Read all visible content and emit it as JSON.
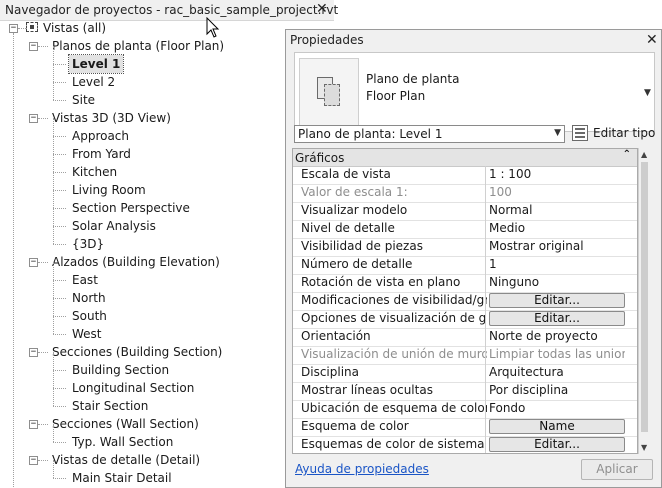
{
  "browser": {
    "title": "Navegador de proyectos - rac_basic_sample_project.rvt",
    "close": "✕",
    "root": "Vistas (all)",
    "tree": [
      {
        "label": "Planos de planta (Floor Plan)",
        "level": 1,
        "toggle": "−"
      },
      {
        "label": "Level 1",
        "level": 2,
        "selected": true
      },
      {
        "label": "Level 2",
        "level": 2
      },
      {
        "label": "Site",
        "level": 2
      },
      {
        "label": "Vistas 3D (3D View)",
        "level": 1,
        "toggle": "−"
      },
      {
        "label": "Approach",
        "level": 2
      },
      {
        "label": "From Yard",
        "level": 2
      },
      {
        "label": "Kitchen",
        "level": 2
      },
      {
        "label": "Living Room",
        "level": 2
      },
      {
        "label": "Section Perspective",
        "level": 2
      },
      {
        "label": "Solar Analysis",
        "level": 2
      },
      {
        "label": "{3D}",
        "level": 2
      },
      {
        "label": "Alzados (Building Elevation)",
        "level": 1,
        "toggle": "−"
      },
      {
        "label": "East",
        "level": 2
      },
      {
        "label": "North",
        "level": 2
      },
      {
        "label": "South",
        "level": 2
      },
      {
        "label": "West",
        "level": 2
      },
      {
        "label": "Secciones (Building Section)",
        "level": 1,
        "toggle": "−"
      },
      {
        "label": "Building Section",
        "level": 2
      },
      {
        "label": "Longitudinal Section",
        "level": 2
      },
      {
        "label": "Stair Section",
        "level": 2
      },
      {
        "label": "Secciones (Wall Section)",
        "level": 1,
        "toggle": "−"
      },
      {
        "label": "Typ. Wall Section",
        "level": 2
      },
      {
        "label": "Vistas de detalle (Detail)",
        "level": 1,
        "toggle": "−"
      },
      {
        "label": "Main Stair Detail",
        "level": 2
      }
    ]
  },
  "properties": {
    "title": "Propiedades",
    "close": "✕",
    "type_name_line1": "Plano de planta",
    "type_name_line2": "Floor Plan",
    "filter_label": "Plano de planta: Level 1",
    "edit_type_label": "Editar tipo",
    "group_label": "Gráficos",
    "group_collapse": "⌃⌃",
    "rows": [
      {
        "name": "Escala de vista",
        "value": "1 : 100"
      },
      {
        "name": "Valor de escala    1:",
        "value": "100",
        "disabled": true
      },
      {
        "name": "Visualizar modelo",
        "value": "Normal"
      },
      {
        "name": "Nivel de detalle",
        "value": "Medio"
      },
      {
        "name": "Visibilidad de piezas",
        "value": "Mostrar original"
      },
      {
        "name": "Número de detalle",
        "value": "1"
      },
      {
        "name": "Rotación de vista en plano",
        "value": "Ninguno"
      },
      {
        "name": "Modificaciones de visibilidad/grá...",
        "value": "Editar...",
        "button": true
      },
      {
        "name": "Opciones de visualización de grá...",
        "value": "Editar...",
        "button": true
      },
      {
        "name": "Orientación",
        "value": "Norte de proyecto"
      },
      {
        "name": "Visualización de unión de muros",
        "value": "Limpiar todas las union...",
        "disabled": true
      },
      {
        "name": "Disciplina",
        "value": "Arquitectura"
      },
      {
        "name": "Mostrar líneas ocultas",
        "value": "Por disciplina"
      },
      {
        "name": "Ubicación de esquema de color",
        "value": "Fondo"
      },
      {
        "name": "Esquema de color",
        "value": "Name",
        "button": true
      },
      {
        "name": "Esquemas de color de sistema",
        "value": "Editar...",
        "button": true
      }
    ],
    "help_link": "Ayuda de propiedades",
    "apply_label": "Aplicar"
  }
}
